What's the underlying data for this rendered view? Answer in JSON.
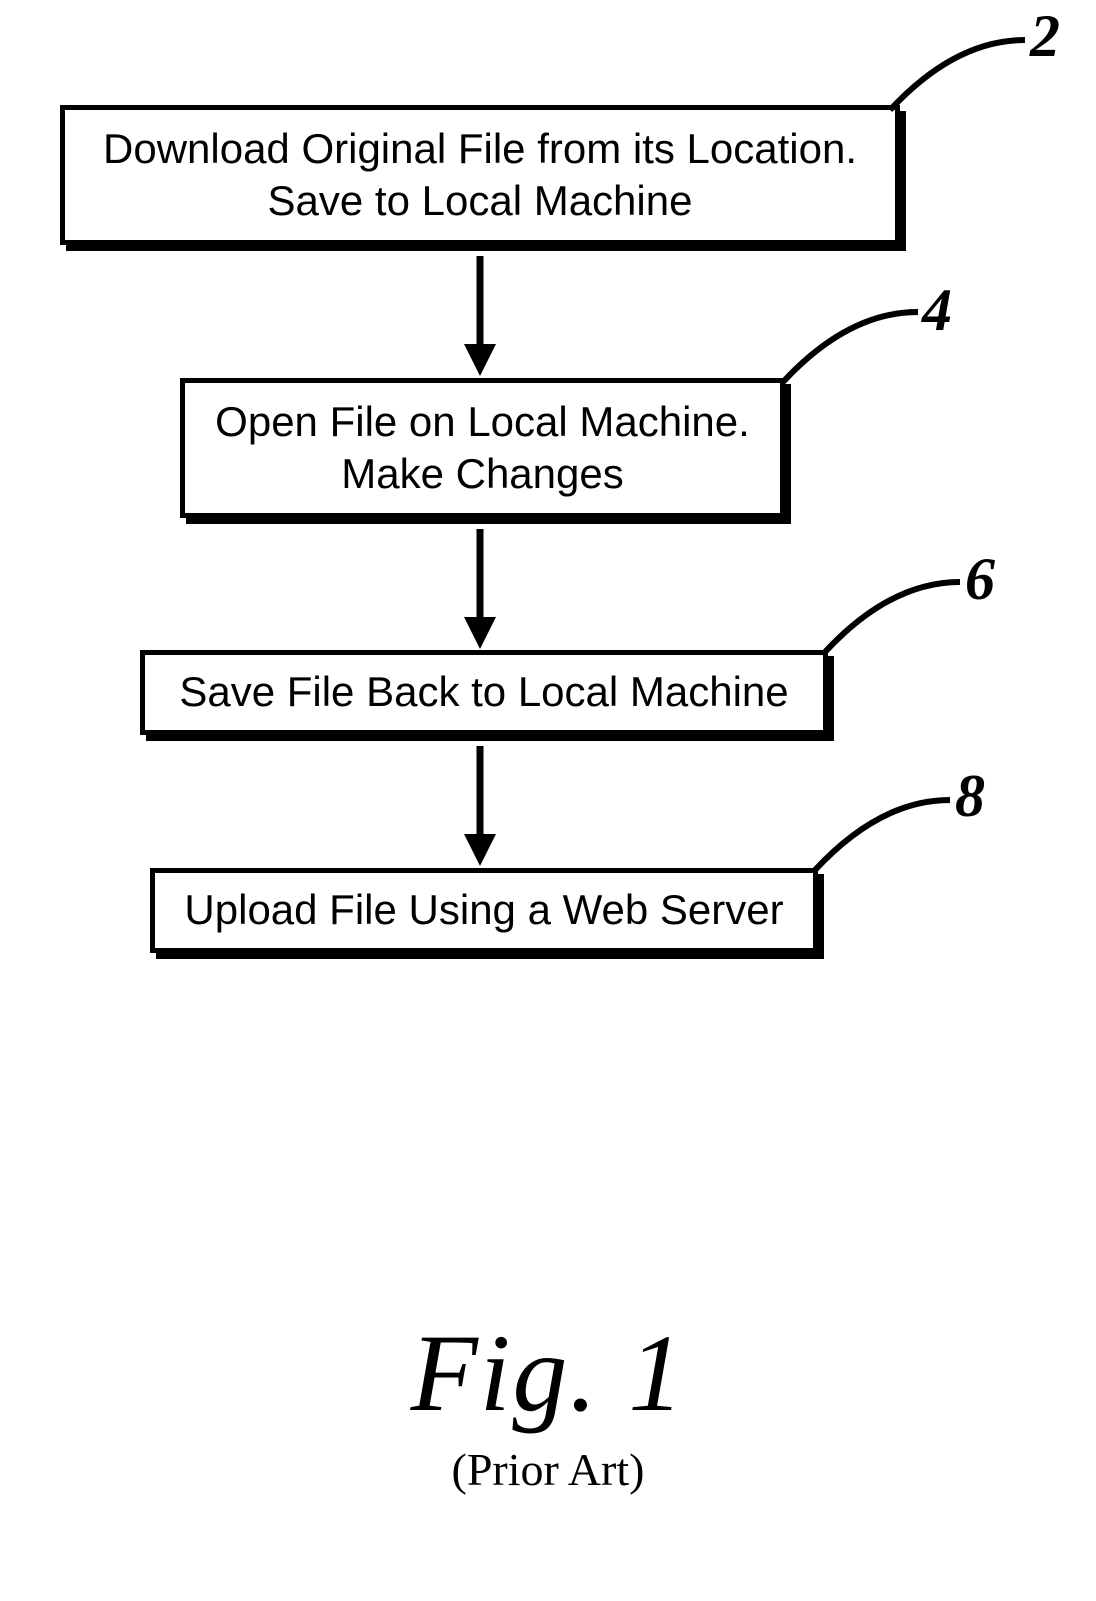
{
  "steps": [
    {
      "id": "2",
      "line1": "Download Original File from its Location.",
      "line2": "Save to Local Machine"
    },
    {
      "id": "4",
      "line1": "Open File on Local Machine.",
      "line2": "Make Changes"
    },
    {
      "id": "6",
      "line1": "Save File Back to Local Machine",
      "line2": ""
    },
    {
      "id": "8",
      "line1": "Upload File Using a Web Server",
      "line2": ""
    }
  ],
  "caption": {
    "figure": "Fig. 1",
    "subtitle": "(Prior Art)"
  }
}
